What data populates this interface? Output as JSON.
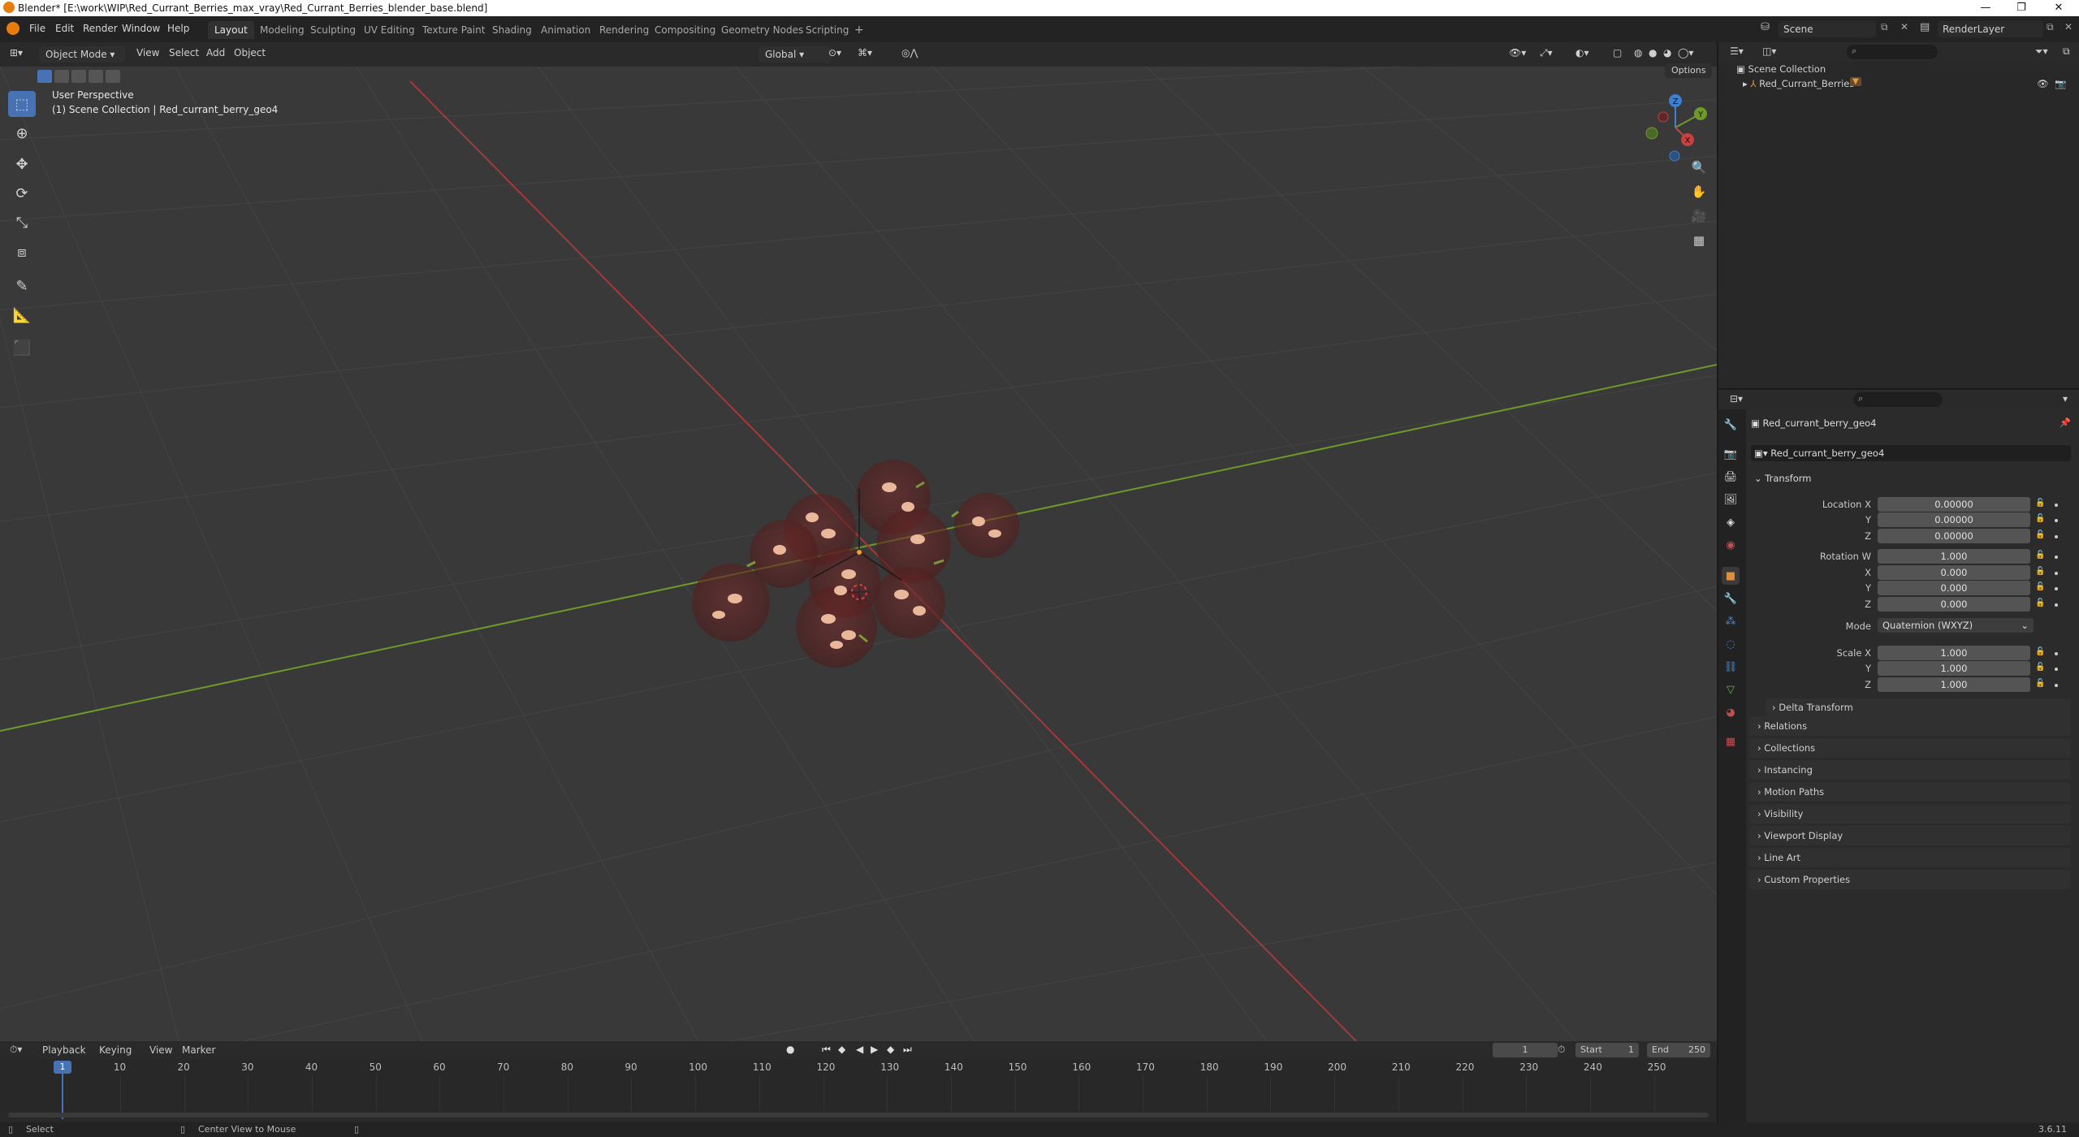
{
  "window": {
    "title": "Blender* [E:\\work\\WIP\\Red_Currant_Berries_max_vray\\Red_Currant_Berries_blender_base.blend]",
    "minimize": "—",
    "maximize": "❐",
    "close": "✕"
  },
  "menu": {
    "items": [
      "File",
      "Edit",
      "Render",
      "Window",
      "Help"
    ]
  },
  "workspaces": [
    "Layout",
    "Modeling",
    "Sculpting",
    "UV Editing",
    "Texture Paint",
    "Shading",
    "Animation",
    "Rendering",
    "Compositing",
    "Geometry Nodes",
    "Scripting"
  ],
  "workspace_add": "+",
  "scene": {
    "name": "Scene",
    "layer": "RenderLayer"
  },
  "viewport": {
    "mode": "Object Mode",
    "menus": [
      "View",
      "Select",
      "Add",
      "Object"
    ],
    "orientation": "Global",
    "options": "Options",
    "overlay_title": "User Perspective",
    "overlay_subtitle": "(1) Scene Collection | Red_currant_berry_geo4",
    "gizmo": {
      "x": "X",
      "y": "Y",
      "z": "Z"
    }
  },
  "outliner": {
    "root": "Scene Collection",
    "items": [
      {
        "label": "Red_Currant_Berries"
      }
    ]
  },
  "properties": {
    "object_name": "Red_currant_berry_geo4",
    "data_name": "Red_currant_berry_geo4",
    "transform_title": "Transform",
    "location_label": "Location X",
    "location": [
      "0.00000",
      "0.00000",
      "0.00000"
    ],
    "rotation_label": "Rotation W",
    "rotation": [
      "1.000",
      "0.000",
      "0.000",
      "0.000"
    ],
    "mode_label": "Mode",
    "mode_value": "Quaternion (WXYZ)",
    "scale_label": "Scale X",
    "scale": [
      "1.000",
      "1.000",
      "1.000"
    ],
    "axis_labels": {
      "x": "X",
      "y": "Y",
      "z": "Z"
    },
    "delta": "Delta Transform",
    "panels": [
      "Relations",
      "Collections",
      "Instancing",
      "Motion Paths",
      "Visibility",
      "Viewport Display",
      "Line Art",
      "Custom Properties"
    ]
  },
  "timeline": {
    "menus": [
      "Playback",
      "Keying",
      "View",
      "Marker"
    ],
    "current_frame": "1",
    "start_label": "Start",
    "start": "1",
    "end_label": "End",
    "end": "250",
    "ticks": [
      "10",
      "20",
      "30",
      "40",
      "50",
      "60",
      "70",
      "80",
      "90",
      "100",
      "110",
      "120",
      "130",
      "140",
      "150",
      "160",
      "170",
      "180",
      "190",
      "200",
      "210",
      "220",
      "230",
      "240",
      "250"
    ]
  },
  "status": {
    "left": "Select",
    "middle": "Center View to Mouse",
    "version": "3.6.11"
  },
  "colors": {
    "accent": "#4772b3",
    "x_axis": "#a33a3a",
    "y_axis": "#6f9a2a",
    "berry": "#8a2a2a"
  }
}
